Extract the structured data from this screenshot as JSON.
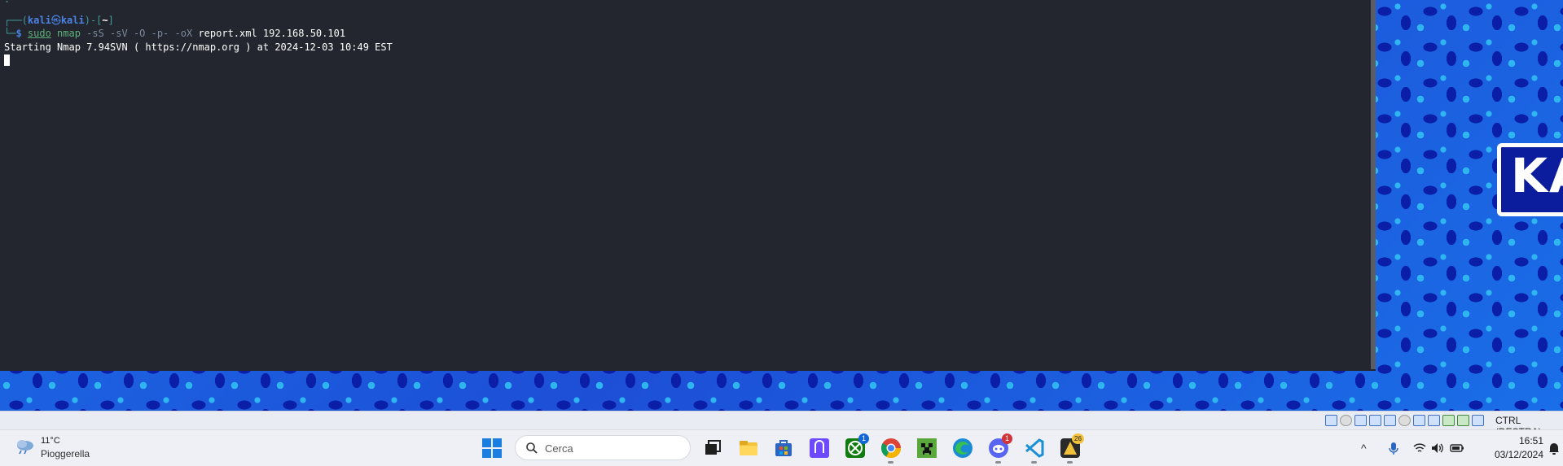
{
  "terminal": {
    "line0_frame": "┌──(",
    "user": "kali",
    "skull": "㉿",
    "host": "kali",
    "line1_mid": ")-[",
    "cwd": "~",
    "line1_end": "]",
    "line2_frame": "└─",
    "prompt": "$ ",
    "cmd_sudo": "sudo",
    "cmd_name": " nmap",
    "cmd_flags": " -sS -sV -O -p- -oX",
    "cmd_args": " report.xml 192.168.50.101",
    "output_line": "Starting Nmap 7.94SVN ( https://nmap.org ) at 2024-12-03 10:49 EST"
  },
  "wallpaper": {
    "logo_text": "KA"
  },
  "vbox": {
    "host_key_label": "CTRL (DESTRA)",
    "icons": [
      "hard-disk-icon",
      "optical-drive-icon",
      "audio-icon",
      "network-icon",
      "usb-icon",
      "shared-folders-icon",
      "display-icon",
      "video-capture-icon",
      "recording-icon",
      "cpu-icon",
      "mouse-integration-icon",
      "keyboard-icon"
    ]
  },
  "taskbar": {
    "weather_temp": "11°C",
    "weather_desc": "Pioggerella",
    "search_placeholder": "Cerca",
    "apps": [
      "task-view",
      "file-explorer",
      "microsoft-store",
      "proton-vpn",
      "xbox",
      "chrome",
      "minecraft",
      "edge",
      "discord",
      "visual-studio-code",
      "fairy-app"
    ],
    "xbox_badge": "1",
    "discord_badge": "1",
    "fairy_badge": "26",
    "clock_time": "16:51",
    "clock_date": "03/12/2024"
  },
  "colors": {
    "terminal_bg": "#23262e",
    "prompt_blue": "#4b83e6",
    "frame_teal": "#3f9b9b",
    "cmd_green": "#5fb07a",
    "taskbar_bg": "#eef0f6"
  }
}
